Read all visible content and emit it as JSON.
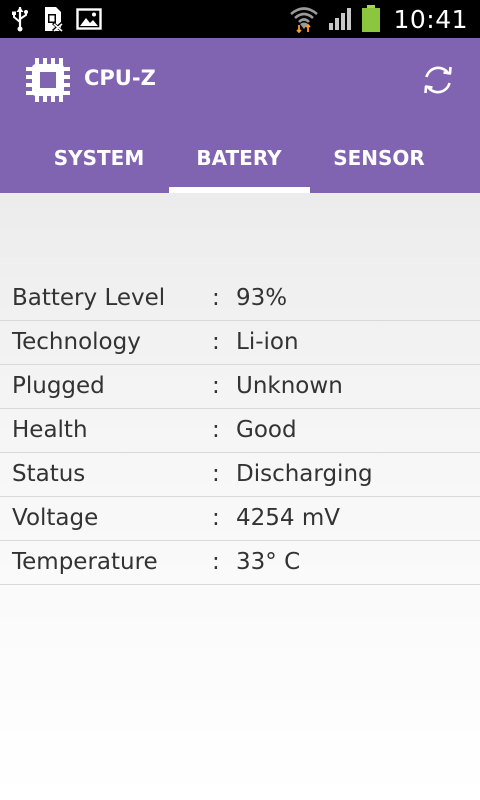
{
  "status_bar": {
    "time": "10:41",
    "icons": [
      "usb-icon",
      "sim-card-icon",
      "image-icon",
      "wifi-icon",
      "signal-icon",
      "battery-icon"
    ]
  },
  "app": {
    "title": "CPU-Z",
    "logo_icon": "chip-icon",
    "refresh_icon": "refresh-icon",
    "theme_color": "#8063b1"
  },
  "tabs": [
    {
      "label": "SYSTEM",
      "active": false
    },
    {
      "label": "BATERY",
      "active": true
    },
    {
      "label": "SENSOR",
      "active": false
    }
  ],
  "battery_info": {
    "separator": ":",
    "rows": [
      {
        "label": "Battery Level",
        "value": "93%"
      },
      {
        "label": "Technology",
        "value": "Li-ion"
      },
      {
        "label": "Plugged",
        "value": "Unknown"
      },
      {
        "label": "Health",
        "value": "Good"
      },
      {
        "label": "Status",
        "value": "Discharging"
      },
      {
        "label": "Voltage",
        "value": "4254 mV"
      },
      {
        "label": "Temperature",
        "value": "33° C"
      }
    ]
  }
}
